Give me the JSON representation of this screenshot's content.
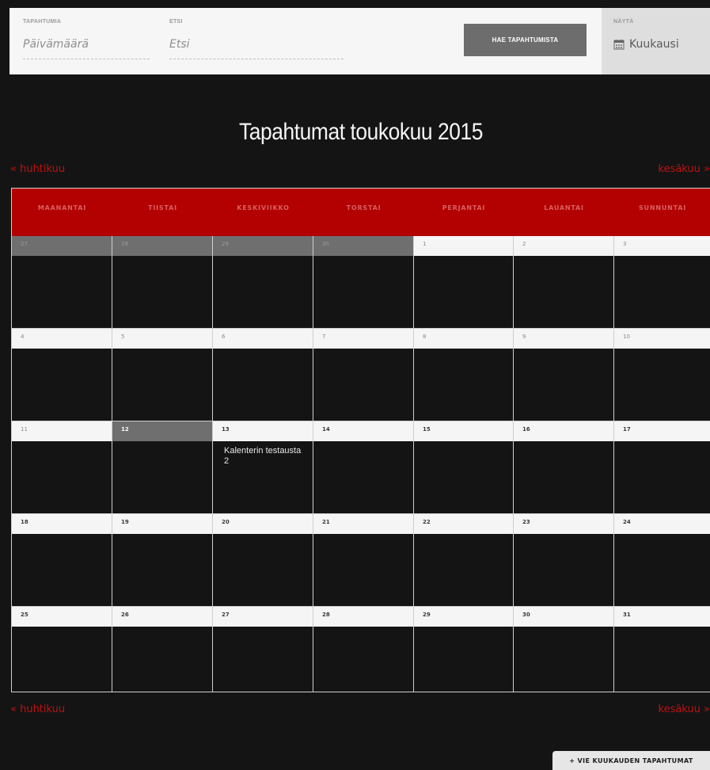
{
  "filters": {
    "date_label": "TAPAHTUMIA",
    "date_placeholder": "Päivämäärä",
    "search_label": "ETSI",
    "search_placeholder": "Etsi",
    "search_button": "HAE TAPAHTUMISTA",
    "view_label": "NÄYTÄ",
    "view_value": "Kuukausi"
  },
  "calendar": {
    "title": "Tapahtumat toukokuu 2015",
    "prev_month": "« huhtikuu",
    "next_month": "kesäkuu »",
    "days": [
      "MAANANTAI",
      "TIISTAI",
      "KESKIVIIKKO",
      "TORSTAI",
      "PERJANTAI",
      "LAUANTAI",
      "SUNNUNTAI"
    ],
    "weeks": [
      [
        {
          "n": "27",
          "s": "past"
        },
        {
          "n": "28",
          "s": "past"
        },
        {
          "n": "29",
          "s": "past"
        },
        {
          "n": "30",
          "s": "past"
        },
        {
          "n": "1",
          "s": ""
        },
        {
          "n": "2",
          "s": ""
        },
        {
          "n": "3",
          "s": ""
        }
      ],
      [
        {
          "n": "4",
          "s": ""
        },
        {
          "n": "5",
          "s": ""
        },
        {
          "n": "6",
          "s": ""
        },
        {
          "n": "7",
          "s": ""
        },
        {
          "n": "8",
          "s": ""
        },
        {
          "n": "9",
          "s": ""
        },
        {
          "n": "10",
          "s": ""
        }
      ],
      [
        {
          "n": "11",
          "s": ""
        },
        {
          "n": "12",
          "s": "today"
        },
        {
          "n": "13",
          "s": "bold",
          "event": "Kalenterin testausta 2"
        },
        {
          "n": "14",
          "s": "bold"
        },
        {
          "n": "15",
          "s": "bold"
        },
        {
          "n": "16",
          "s": "bold"
        },
        {
          "n": "17",
          "s": "bold"
        }
      ],
      [
        {
          "n": "18",
          "s": "bold"
        },
        {
          "n": "19",
          "s": "bold"
        },
        {
          "n": "20",
          "s": "bold"
        },
        {
          "n": "21",
          "s": "bold"
        },
        {
          "n": "22",
          "s": "bold"
        },
        {
          "n": "23",
          "s": "bold"
        },
        {
          "n": "24",
          "s": "bold"
        }
      ],
      [
        {
          "n": "25",
          "s": "bold"
        },
        {
          "n": "26",
          "s": "bold"
        },
        {
          "n": "27",
          "s": "bold"
        },
        {
          "n": "28",
          "s": "bold"
        },
        {
          "n": "29",
          "s": "bold"
        },
        {
          "n": "30",
          "s": "bold"
        },
        {
          "n": "31",
          "s": "bold"
        }
      ]
    ]
  },
  "export_button": "+ VIE KUUKAUDEN TAPAHTUMAT",
  "colors": {
    "accent": "#b30000",
    "link": "#c01010",
    "background": "#141414"
  },
  "icons": {
    "view": "calendar-icon"
  }
}
